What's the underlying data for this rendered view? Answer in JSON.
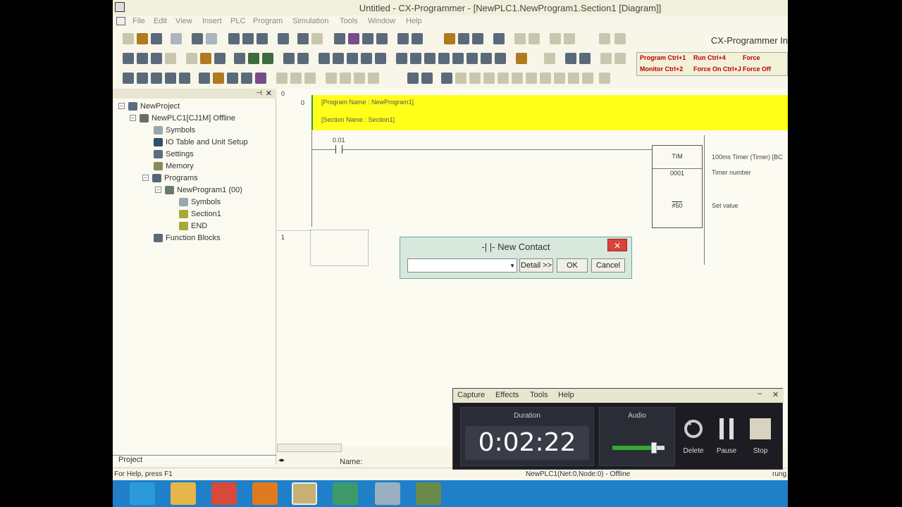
{
  "window": {
    "title": "Untitled - CX-Programmer - [NewPLC1.NewProgram1.Section1 [Diagram]]"
  },
  "menu": [
    "File",
    "Edit",
    "View",
    "Insert",
    "PLC",
    "Program",
    "Simulation",
    "Tools",
    "Window",
    "Help"
  ],
  "brand": "CX-Programmer In",
  "shortcut_panel": [
    "Program Ctrl+1",
    "Run Ctrl+4",
    "Force",
    "Monitor Ctrl+2",
    "Force On Ctrl+J",
    "Force Off"
  ],
  "project_tree": {
    "items": [
      {
        "label": "NewProject",
        "icon": "project-icon"
      },
      {
        "label": "NewPLC1[CJ1M] Offline",
        "icon": "plc-icon"
      },
      {
        "label": "Symbols",
        "icon": "symbols-icon"
      },
      {
        "label": "IO Table and Unit Setup",
        "icon": "io-table-icon"
      },
      {
        "label": "Settings",
        "icon": "settings-icon"
      },
      {
        "label": "Memory",
        "icon": "memory-icon"
      },
      {
        "label": "Programs",
        "icon": "programs-icon"
      },
      {
        "label": "NewProgram1 (00)",
        "icon": "program-icon"
      },
      {
        "label": "Symbols",
        "icon": "symbols-icon"
      },
      {
        "label": "Section1",
        "icon": "section-icon"
      },
      {
        "label": "END",
        "icon": "section-icon"
      },
      {
        "label": "Function Blocks",
        "icon": "function-blocks-icon"
      }
    ],
    "tab": "Project"
  },
  "diagram": {
    "rung0_number": "0",
    "rung0_step": "0",
    "program_name": "[Program Name : NewProgram1]",
    "section_name": "[Section Name : Section1]",
    "contact_address": "0.01",
    "timer": {
      "instr": "TIM",
      "number": "0001",
      "set_value": "#50"
    },
    "timer_comment": "100ms Timer (Timer) [BC",
    "timer_number_label": "Timer number",
    "set_value_label": "Set value",
    "rung1_number": "1"
  },
  "dialog": {
    "title": "-| |- New Contact",
    "input_value": "",
    "detail_label": "Detail >>",
    "ok_label": "OK",
    "cancel_label": "Cancel"
  },
  "name_bar": {
    "label": "Name:"
  },
  "status_bar": {
    "help": "For Help, press F1",
    "connection": "NewPLC1(Net:0,Node:0) - Offline",
    "right": "rung"
  },
  "recorder": {
    "menu": [
      "Capture",
      "Effects",
      "Tools",
      "Help"
    ],
    "duration_label": "Duration",
    "duration": "0:02:22",
    "audio_label": "Audio",
    "audio_level": 0.8,
    "delete_label": "Delete",
    "pause_label": "Pause",
    "stop_label": "Stop"
  }
}
